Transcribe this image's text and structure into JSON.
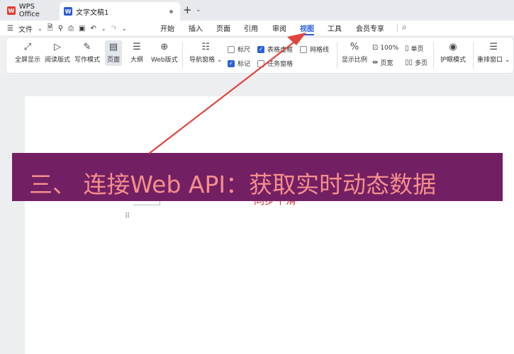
{
  "tabs": {
    "home": "WPS Office",
    "home_logo": "W",
    "doc": "文字文稿1",
    "doc_logo": "W",
    "new_tab": "+"
  },
  "menu": {
    "file": "文件",
    "tabs": [
      "开始",
      "插入",
      "页面",
      "引用",
      "审阅",
      "视图",
      "工具",
      "会员专享"
    ],
    "active_tab": "视图"
  },
  "ribbon": {
    "buttons": {
      "fullscreen": "全屏显示",
      "reading": "阅读版式",
      "writing": "写作模式",
      "page": "页面",
      "outline": "大纲",
      "web": "Web版式",
      "nav": "导航窗格",
      "zoom": "显示比例",
      "eye": "护眼模式",
      "rearrange": "重排窗口"
    },
    "checks": {
      "ruler": "标尺",
      "table_grid": "表格虚框",
      "gridlines": "网格线",
      "mark": "标记",
      "task_pane": "任务窗格"
    },
    "small": {
      "percent": "100%",
      "single": "单页",
      "width": "页宽",
      "multi": "多页"
    }
  },
  "document": {
    "partial_text": "同步平滑"
  },
  "banner": {
    "text": "三、 连接Web API：获取实时动态数据"
  },
  "colors": {
    "banner_bg": "#731f63",
    "banner_text": "#f48f8c",
    "arrow": "#e0443e",
    "accent": "#2b5fd9"
  }
}
